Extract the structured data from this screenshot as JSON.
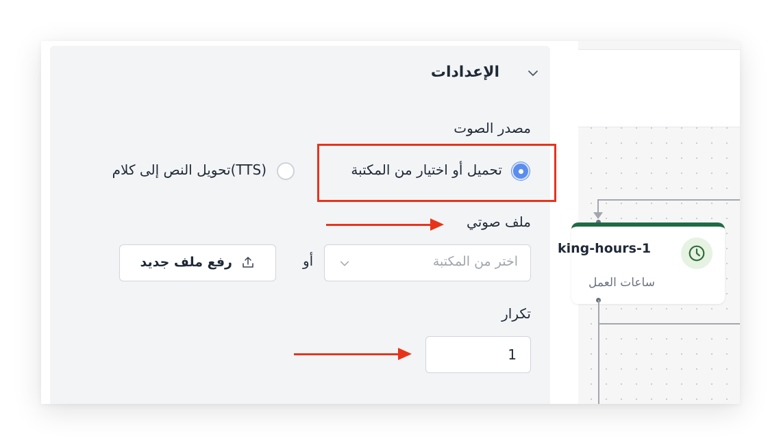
{
  "settings": {
    "title": "الإعدادات"
  },
  "audio_source": {
    "label": "مصدر الصوت",
    "options": [
      {
        "label": "تحميل أو اختيار من المكتبة",
        "selected": true
      },
      {
        "label": "(TTS)تحويل النص إلى كلام",
        "selected": false
      }
    ]
  },
  "audio_file": {
    "label": "ملف صوتي",
    "select_placeholder": "اختر من المكتبة",
    "or_text": "أو",
    "upload_label": "رفع ملف جديد"
  },
  "repeat": {
    "label": "تكرار",
    "value": "1"
  },
  "flow_node": {
    "title": "king-hours-1",
    "subtitle": "ساعات العمل",
    "icon": "clock-icon",
    "accent_color": "#1f6b45"
  },
  "colors": {
    "highlight": "#e8331b",
    "radio_selected": "#5b8def",
    "panel_bg": "#f3f4f6"
  }
}
